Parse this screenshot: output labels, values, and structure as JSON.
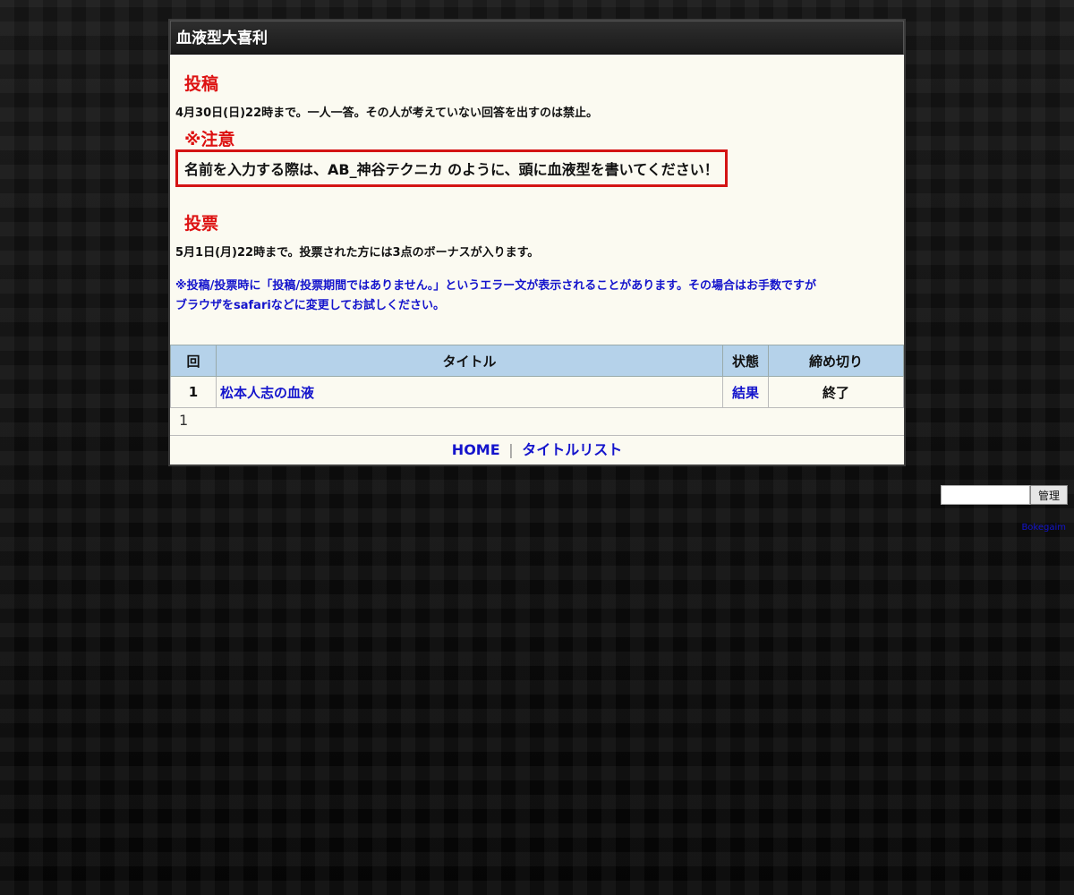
{
  "window": {
    "title": "血液型大喜利"
  },
  "post_section": {
    "heading": "投稿",
    "text": "4月30日(日)22時まで。一人一答。その人が考えていない回答を出すのは禁止。"
  },
  "note_section": {
    "heading": "※注意",
    "notice": "名前を入力する際は、AB_神谷テクニカ のように、頭に血液型を書いてください！"
  },
  "vote_section": {
    "heading": "投票",
    "text": "5月1日(月)22時まで。投票された方には3点のボーナスが入ります。"
  },
  "warning": {
    "line1": "※投稿/投票時に「投稿/投票期間ではありません。」というエラー文が表示されることがあります。その場合はお手数ですが",
    "line2": "ブラウザをsafariなどに変更してお試しください。"
  },
  "table": {
    "headers": {
      "num": "回",
      "title": "タイトル",
      "status": "状態",
      "deadline": "締め切り"
    },
    "rows": [
      {
        "num": "1",
        "title": "松本人志の血液",
        "status": "結果",
        "deadline": "終了"
      }
    ]
  },
  "pager": {
    "page": "1"
  },
  "footer": {
    "home": "HOME",
    "separator": "|",
    "title_list": "タイトルリスト"
  },
  "admin": {
    "input_value": "",
    "button_label": "管理"
  },
  "credit": "Bokegaim",
  "colors": {
    "accent_red": "#dd1111",
    "link_blue": "#1414cc",
    "header_blue": "#b5d2ea",
    "panel_bg": "#fbfaf1"
  }
}
